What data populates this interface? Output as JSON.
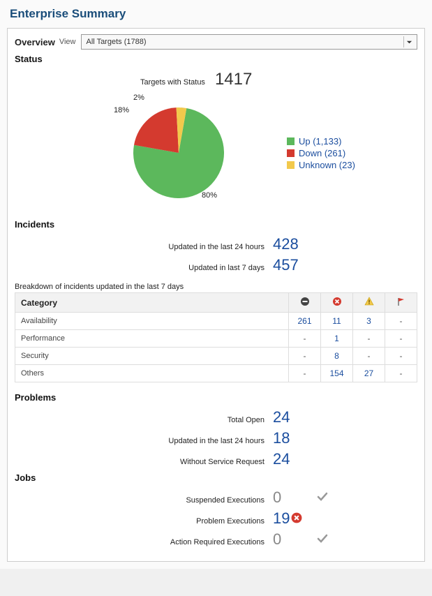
{
  "page_title": "Enterprise Summary",
  "overview_label": "Overview",
  "view_label": "View",
  "view_select": {
    "selected": "All Targets (1788)"
  },
  "status": {
    "heading": "Status",
    "targets_label": "Targets with Status",
    "targets_value": "1417"
  },
  "chart_data": {
    "type": "pie",
    "title": "Targets with Status",
    "total": 1417,
    "series": [
      {
        "name": "Up",
        "value": 1133,
        "percent": 80,
        "label": "Up (1,133)",
        "color": "#5cb85c"
      },
      {
        "name": "Down",
        "value": 261,
        "percent": 18,
        "label": "Down (261)",
        "color": "#d43a2f"
      },
      {
        "name": "Unknown",
        "value": 23,
        "percent": 2,
        "label": "Unknown (23)",
        "color": "#f2c94c"
      }
    ],
    "pct_labels": {
      "up": "80%",
      "down": "18%",
      "unknown": "2%"
    }
  },
  "incidents": {
    "heading": "Incidents",
    "updated24_label": "Updated in the last 24 hours",
    "updated24_value": "428",
    "updated7_label": "Updated in last 7 days",
    "updated7_value": "457",
    "breakdown_caption": "Breakdown of incidents updated in the last 7 days",
    "columns": {
      "category": "Category"
    },
    "rows": [
      {
        "category": "Availability",
        "blackout": "261",
        "fatal": "11",
        "warning": "3",
        "flag": "-"
      },
      {
        "category": "Performance",
        "blackout": "-",
        "fatal": "1",
        "warning": "-",
        "flag": "-"
      },
      {
        "category": "Security",
        "blackout": "-",
        "fatal": "8",
        "warning": "-",
        "flag": "-"
      },
      {
        "category": "Others",
        "blackout": "-",
        "fatal": "154",
        "warning": "27",
        "flag": "-"
      }
    ]
  },
  "problems": {
    "heading": "Problems",
    "total_open_label": "Total Open",
    "total_open_value": "24",
    "updated24_label": "Updated in the last 24 hours",
    "updated24_value": "18",
    "without_sr_label": "Without Service Request",
    "without_sr_value": "24"
  },
  "jobs": {
    "heading": "Jobs",
    "suspended_label": "Suspended Executions",
    "suspended_value": "0",
    "problem_label": "Problem Executions",
    "problem_value": "19",
    "action_label": "Action Required Executions",
    "action_value": "0"
  }
}
